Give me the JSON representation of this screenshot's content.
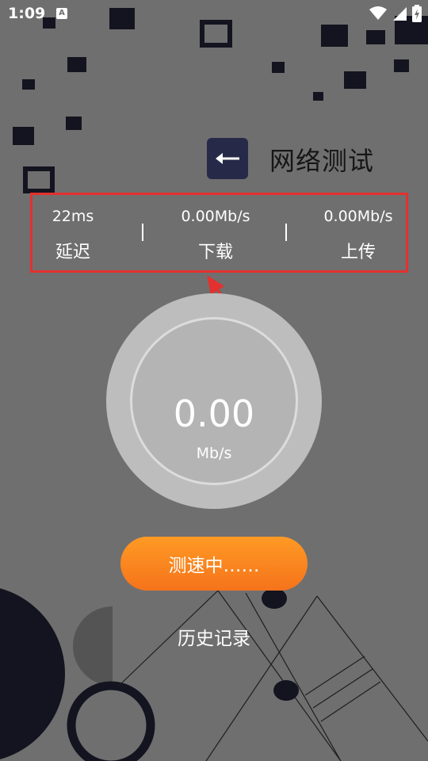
{
  "status_bar": {
    "time": "1:09",
    "notification_letter": "A"
  },
  "header": {
    "title": "网络测试"
  },
  "stats": {
    "latency": {
      "value": "22ms",
      "label": "延迟"
    },
    "download": {
      "value": "0.00Mb/s",
      "label": "下载"
    },
    "upload": {
      "value": "0.00Mb/s",
      "label": "上传"
    }
  },
  "gauge": {
    "value": "0.00",
    "unit": "Mb/s"
  },
  "actions": {
    "test_button_label": "测速中……",
    "history_label": "历史记录"
  },
  "colors": {
    "background": "#6f6f6f",
    "dark": "#13141f",
    "highlight": "#e3312f",
    "accent_start": "#ff9a24",
    "accent_end": "#f5731b"
  },
  "icons": [
    "wifi-icon",
    "cell-signal-icon",
    "battery-charging-icon",
    "back-arrow-icon"
  ]
}
